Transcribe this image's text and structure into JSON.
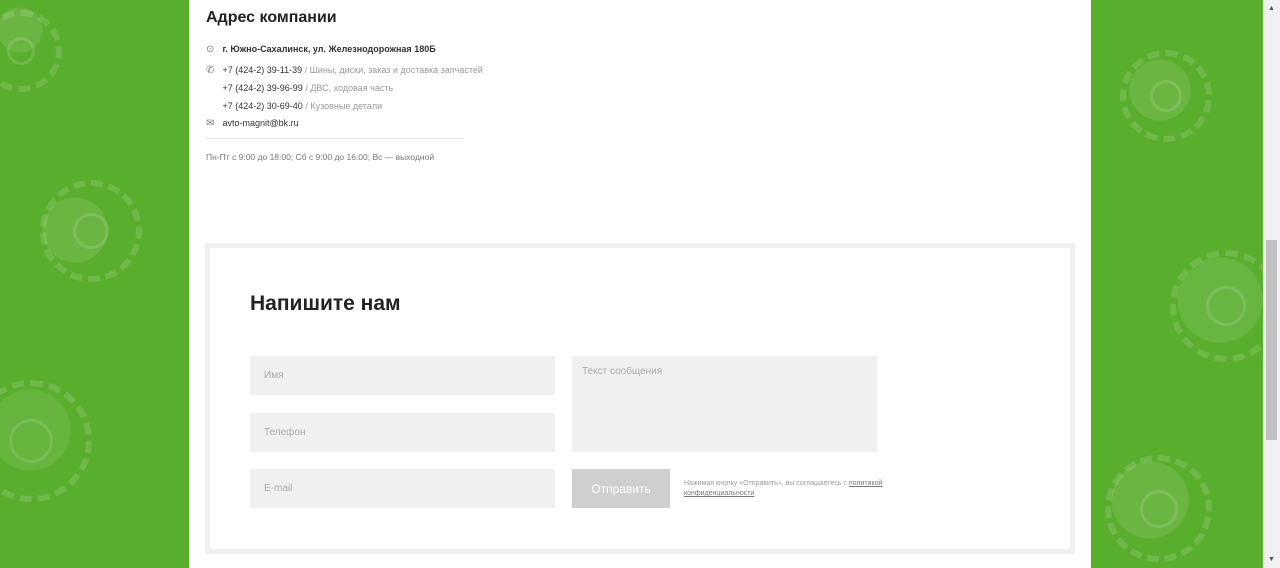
{
  "address": {
    "title": "Адрес компании",
    "street": "г. Южно-Сахалинск, ул. Железнодорожная 180Б",
    "phones": [
      {
        "number": "+7 (424-2) 39-11-39",
        "desc": " / Шины, диски, заказ и доставка запчастей"
      },
      {
        "number": "+7 (424-2) 39-96-99",
        "desc": " / ДВС, ходовая часть"
      },
      {
        "number": "+7 (424-2) 30-69-40",
        "desc": " / Кузовные детали"
      }
    ],
    "email": "avto-magnit@bk.ru",
    "hours": "Пн-Пт с 9:00 до 18:00; Сб с 9:00 до 16:00; Вс — выходной"
  },
  "form": {
    "title": "Напишите нам",
    "name_placeholder": "Имя",
    "phone_placeholder": "Телефон",
    "email_placeholder": "E-mail",
    "message_placeholder": "Текст сообщения",
    "submit_label": "Отправить",
    "consent_text": "Нажимая кнопку «Отправить», вы соглашаетесь с ",
    "policy_link": "политикой конфиденциальности"
  },
  "icons": {
    "location": "location-pin-icon",
    "phone": "phone-icon",
    "mail": "mail-icon"
  },
  "colors": {
    "brand_green": "#5aae2e",
    "field_bg": "#f0f0f0",
    "button_disabled": "#cfcfcf"
  }
}
